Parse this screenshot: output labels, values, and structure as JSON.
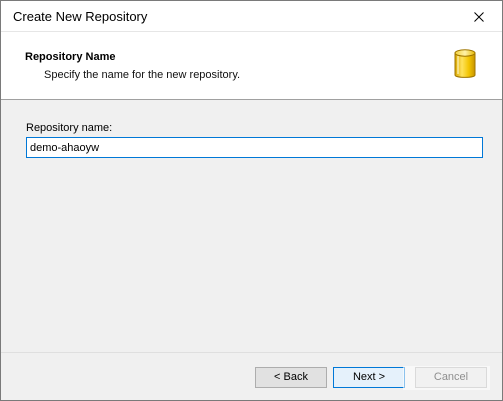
{
  "window": {
    "title": "Create New Repository",
    "close_icon": "close-icon"
  },
  "header": {
    "title": "Repository Name",
    "subtitle": "Specify the name for the new repository.",
    "icon": "database-cylinder-icon",
    "icon_color": "#f2c400"
  },
  "form": {
    "repository_name_label": "Repository name:",
    "repository_name_value": "demo-ahaoyw"
  },
  "footer": {
    "back_label": "< Back",
    "next_label": "Next >",
    "cancel_label": "Cancel"
  },
  "colors": {
    "focus_border": "#0078d7",
    "dialog_background": "#f0f0f0",
    "header_background": "#ffffff"
  }
}
